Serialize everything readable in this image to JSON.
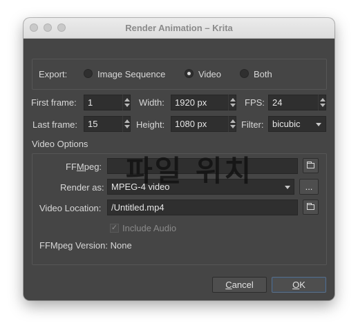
{
  "window": {
    "title": "Render Animation – Krita"
  },
  "export": {
    "label": "Export:",
    "options": [
      "Image Sequence",
      "Video",
      "Both"
    ],
    "selected": "Video"
  },
  "first_frame": {
    "label": "First frame:",
    "value": "1"
  },
  "last_frame": {
    "label": "Last frame:",
    "value": "15"
  },
  "width": {
    "label": "Width:",
    "value": "1920 px"
  },
  "height": {
    "label": "Height:",
    "value": "1080 px"
  },
  "fps": {
    "label": "FPS:",
    "value": "24"
  },
  "filter": {
    "label": "Filter:",
    "value": "bicubic"
  },
  "video_options": {
    "section_label": "Video Options",
    "ffmpeg_label_pre": "FF",
    "ffmpeg_label_mid": "M",
    "ffmpeg_label_post": "peg:",
    "ffmpeg_path": "",
    "render_as_label": "Render as:",
    "render_as_value": "MPEG-4 video",
    "more_button": "...",
    "video_location_label": "Video Location:",
    "video_location_value": "/Untitled.mp4",
    "include_audio": "Include Audio",
    "ffmpeg_version": "FFMpeg Version: None"
  },
  "overlay_text": "파일 위치",
  "buttons": {
    "cancel_pre": "",
    "cancel_ul": "C",
    "cancel_post": "ancel",
    "ok_ul": "O",
    "ok_post": "K"
  }
}
